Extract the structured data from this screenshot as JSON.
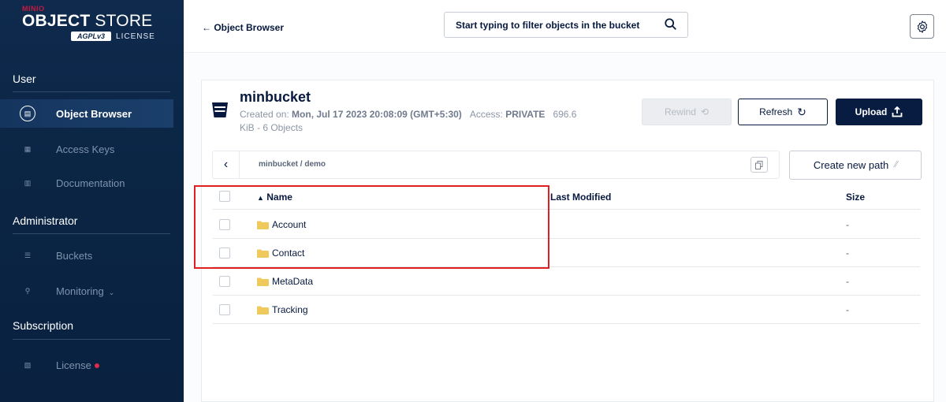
{
  "app": {
    "logo_top": "MINIO",
    "logo_main_bold": "OBJECT",
    "logo_main_light": " STORE",
    "logo_license_badge": "AGPLv3",
    "logo_license_text": "LICENSE"
  },
  "sidebar": {
    "sections": [
      {
        "title": "User"
      },
      {
        "title": "Administrator"
      },
      {
        "title": "Subscription"
      }
    ],
    "items": [
      {
        "label": "Object Browser",
        "active": true,
        "icon": "object-browser-icon"
      },
      {
        "label": "Access Keys",
        "active": false,
        "icon": "key-icon"
      },
      {
        "label": "Documentation",
        "active": false,
        "icon": "document-icon"
      },
      {
        "label": "Buckets",
        "active": false,
        "icon": "bucket-icon"
      },
      {
        "label": "Monitoring",
        "active": false,
        "icon": "search-icon"
      },
      {
        "label": "License",
        "active": false,
        "icon": "license-icon"
      }
    ]
  },
  "topbar": {
    "back_label": "← Object Browser",
    "search_placeholder": "Start typing to filter objects in the bucket"
  },
  "bucket": {
    "name": "minbucket",
    "created_prefix": "Created on: ",
    "created_value": "Mon, Jul 17 2023 20:08:09 (GMT+5:30)",
    "access_prefix": "Access: ",
    "access_value": "PRIVATE",
    "size_info_a": "696.6",
    "size_info_b": "KiB - 6 Objects"
  },
  "actions": {
    "rewind": "Rewind",
    "refresh": "Refresh",
    "upload": "Upload",
    "create_path": "Create new path"
  },
  "path": {
    "current": "minbucket / demo"
  },
  "table": {
    "columns": {
      "name": "Name",
      "last_modified": "Last Modified",
      "size": "Size"
    },
    "rows": [
      {
        "name": "Account",
        "last_modified": "",
        "size": "-"
      },
      {
        "name": "Contact",
        "last_modified": "",
        "size": "-"
      },
      {
        "name": "MetaData",
        "last_modified": "",
        "size": "-"
      },
      {
        "name": "Tracking",
        "last_modified": "",
        "size": "-"
      }
    ]
  },
  "colors": {
    "sidebar_bg": "#0b2545",
    "primary": "#081c42",
    "folder": "#f0c95c",
    "license_dot": "#e0294b",
    "highlight": "#e02020"
  }
}
